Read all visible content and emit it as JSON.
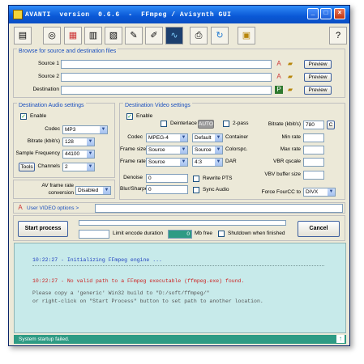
{
  "window": {
    "title": "AVANTI  version  0.6.6  -  FFmpeg / Avisynth GUI"
  },
  "toolbar": {
    "icons": [
      "document-icon",
      "disc-icon",
      "film-color-icon",
      "film-strip-icon",
      "film-clip-icon",
      "notepad-icon",
      "pen-icon",
      "waveform-icon",
      "printer-icon",
      "refresh-icon",
      "calendar-icon",
      "help-icon"
    ]
  },
  "browse": {
    "title": "Browse for source and destination files",
    "source1": "Source 1",
    "source2": "Source 2",
    "destination": "Destination",
    "preview": "Preview"
  },
  "audio": {
    "title": "Destination Audio settings",
    "enable": "Enable",
    "codec_label": "Codec",
    "codec": "MP3",
    "bitrate_label": "Bitrate (kbit/s)",
    "bitrate": "128",
    "samplefreq_label": "Sample Frequency",
    "samplefreq": "44100",
    "tools": "Tools",
    "channels_label": "Channels",
    "channels": "2",
    "avframe_label_1": "AV frame rate",
    "avframe_label_2": "conversion",
    "avframe": "Disabled"
  },
  "video": {
    "title": "Destination Video settings",
    "enable": "Enable",
    "deinterlace": "Deinterlace",
    "auto": "AUTO",
    "twopass": "2-pass",
    "codec_label": "Codec",
    "codec": "MPEG-4",
    "container": "Default",
    "container_label": "Container",
    "framesize_label": "Frame size",
    "framesize": "Source",
    "colorspc": "Source",
    "colorspc_label": "Colorspc.",
    "framerate_label": "Frame rate",
    "framerate": "Source",
    "dar": "4:3",
    "dar_label": "DAR",
    "denoise_label": "Denoise",
    "denoise": "0",
    "blur_label": "Blur/Sharpen",
    "blur": "0",
    "rewrite_pts": "Rewrite PTS",
    "sync_audio": "Sync Audio",
    "bitrate_label": "Bitrate (kbit/s)",
    "bitrate": "780",
    "c": "C",
    "minrate_label": "Min rate",
    "maxrate_label": "Max rate",
    "vbr_label": "VBR qscale",
    "vbv_label": "VBV buffer size",
    "fourcc_label": "Force FourCC to",
    "fourcc": "DIVX"
  },
  "options": {
    "label": "User VIDEO options >"
  },
  "process": {
    "start": "Start process",
    "cancel": "Cancel",
    "limit": "Limit encode duration",
    "mbfree_value": "0",
    "mbfree": "Mb free",
    "shutdown": "Shutdown when finished"
  },
  "log": {
    "lines": [
      "10:22:27 - Initializing FFmpeg engine ...",
      "10:22:27 - No valid path to a FFmpeg executable (ffmpeg.exe) found.",
      "Please copy a 'generic' Win32 build to \"D:/soft/ffmpeg/\"",
      "or right-click on \"Start Process\" button to set path to another location."
    ]
  },
  "status": {
    "text": "System startup failed."
  },
  "colors": {
    "title_bar": "#0a58d6",
    "log_bg": "#c7eaea",
    "log_blue": "#1f3fbf",
    "log_red": "#cc2222",
    "status_bar": "#2e9b84"
  }
}
